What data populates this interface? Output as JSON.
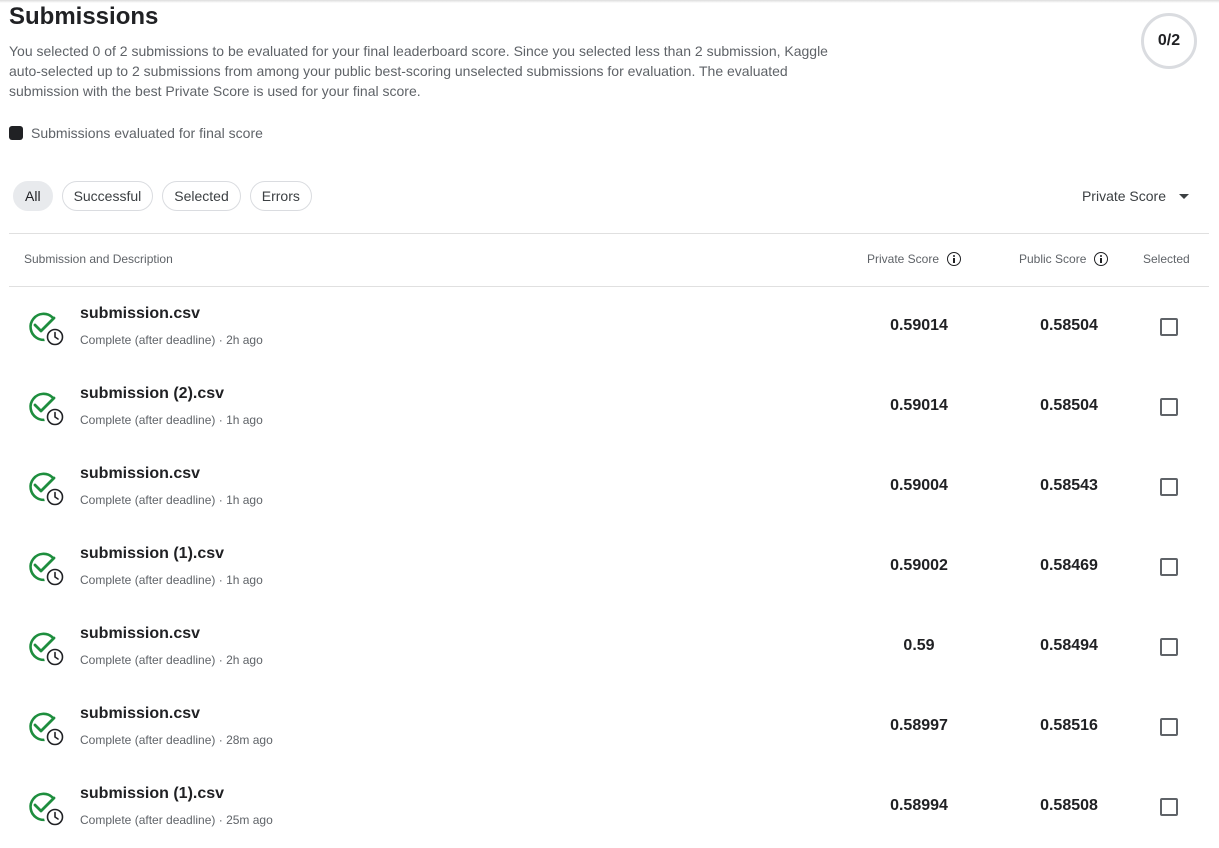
{
  "header": {
    "title": "Submissions",
    "description": "You selected 0 of 2 submissions to be evaluated for your final leaderboard score. Since you selected less than 2 submission, Kaggle auto-selected up to 2 submissions from among your public best-scoring unselected submissions for evaluation. The evaluated submission with the best Private Score is used for your final score.",
    "counter": "0/2"
  },
  "legend": {
    "label": "Submissions evaluated for final score"
  },
  "filters": [
    "All",
    "Successful",
    "Selected",
    "Errors"
  ],
  "active_filter": "All",
  "sort": {
    "label": "Private Score"
  },
  "table": {
    "columns": {
      "submission": "Submission and Description",
      "private": "Private Score",
      "public": "Public Score",
      "selected": "Selected"
    },
    "rows": [
      {
        "name": "submission.csv",
        "meta": "Complete (after deadline) · 2h ago",
        "private": "0.59014",
        "public": "0.58504"
      },
      {
        "name": "submission (2).csv",
        "meta": "Complete (after deadline) · 1h ago",
        "private": "0.59014",
        "public": "0.58504"
      },
      {
        "name": "submission.csv",
        "meta": "Complete (after deadline) · 1h ago",
        "private": "0.59004",
        "public": "0.58543"
      },
      {
        "name": "submission (1).csv",
        "meta": "Complete (after deadline) · 1h ago",
        "private": "0.59002",
        "public": "0.58469"
      },
      {
        "name": "submission.csv",
        "meta": "Complete (after deadline) · 2h ago",
        "private": "0.59",
        "public": "0.58494"
      },
      {
        "name": "submission.csv",
        "meta": "Complete (after deadline) · 28m ago",
        "private": "0.58997",
        "public": "0.58516"
      },
      {
        "name": "submission (1).csv",
        "meta": "Complete (after deadline) · 25m ago",
        "private": "0.58994",
        "public": "0.58508"
      }
    ]
  },
  "colors": {
    "success": "#1e8e3e",
    "text": "#202124",
    "muted": "#5f6368"
  },
  "icons": {
    "status": "check-circle-with-clock-icon",
    "info": "info-icon",
    "sort": "caret-down-icon"
  }
}
